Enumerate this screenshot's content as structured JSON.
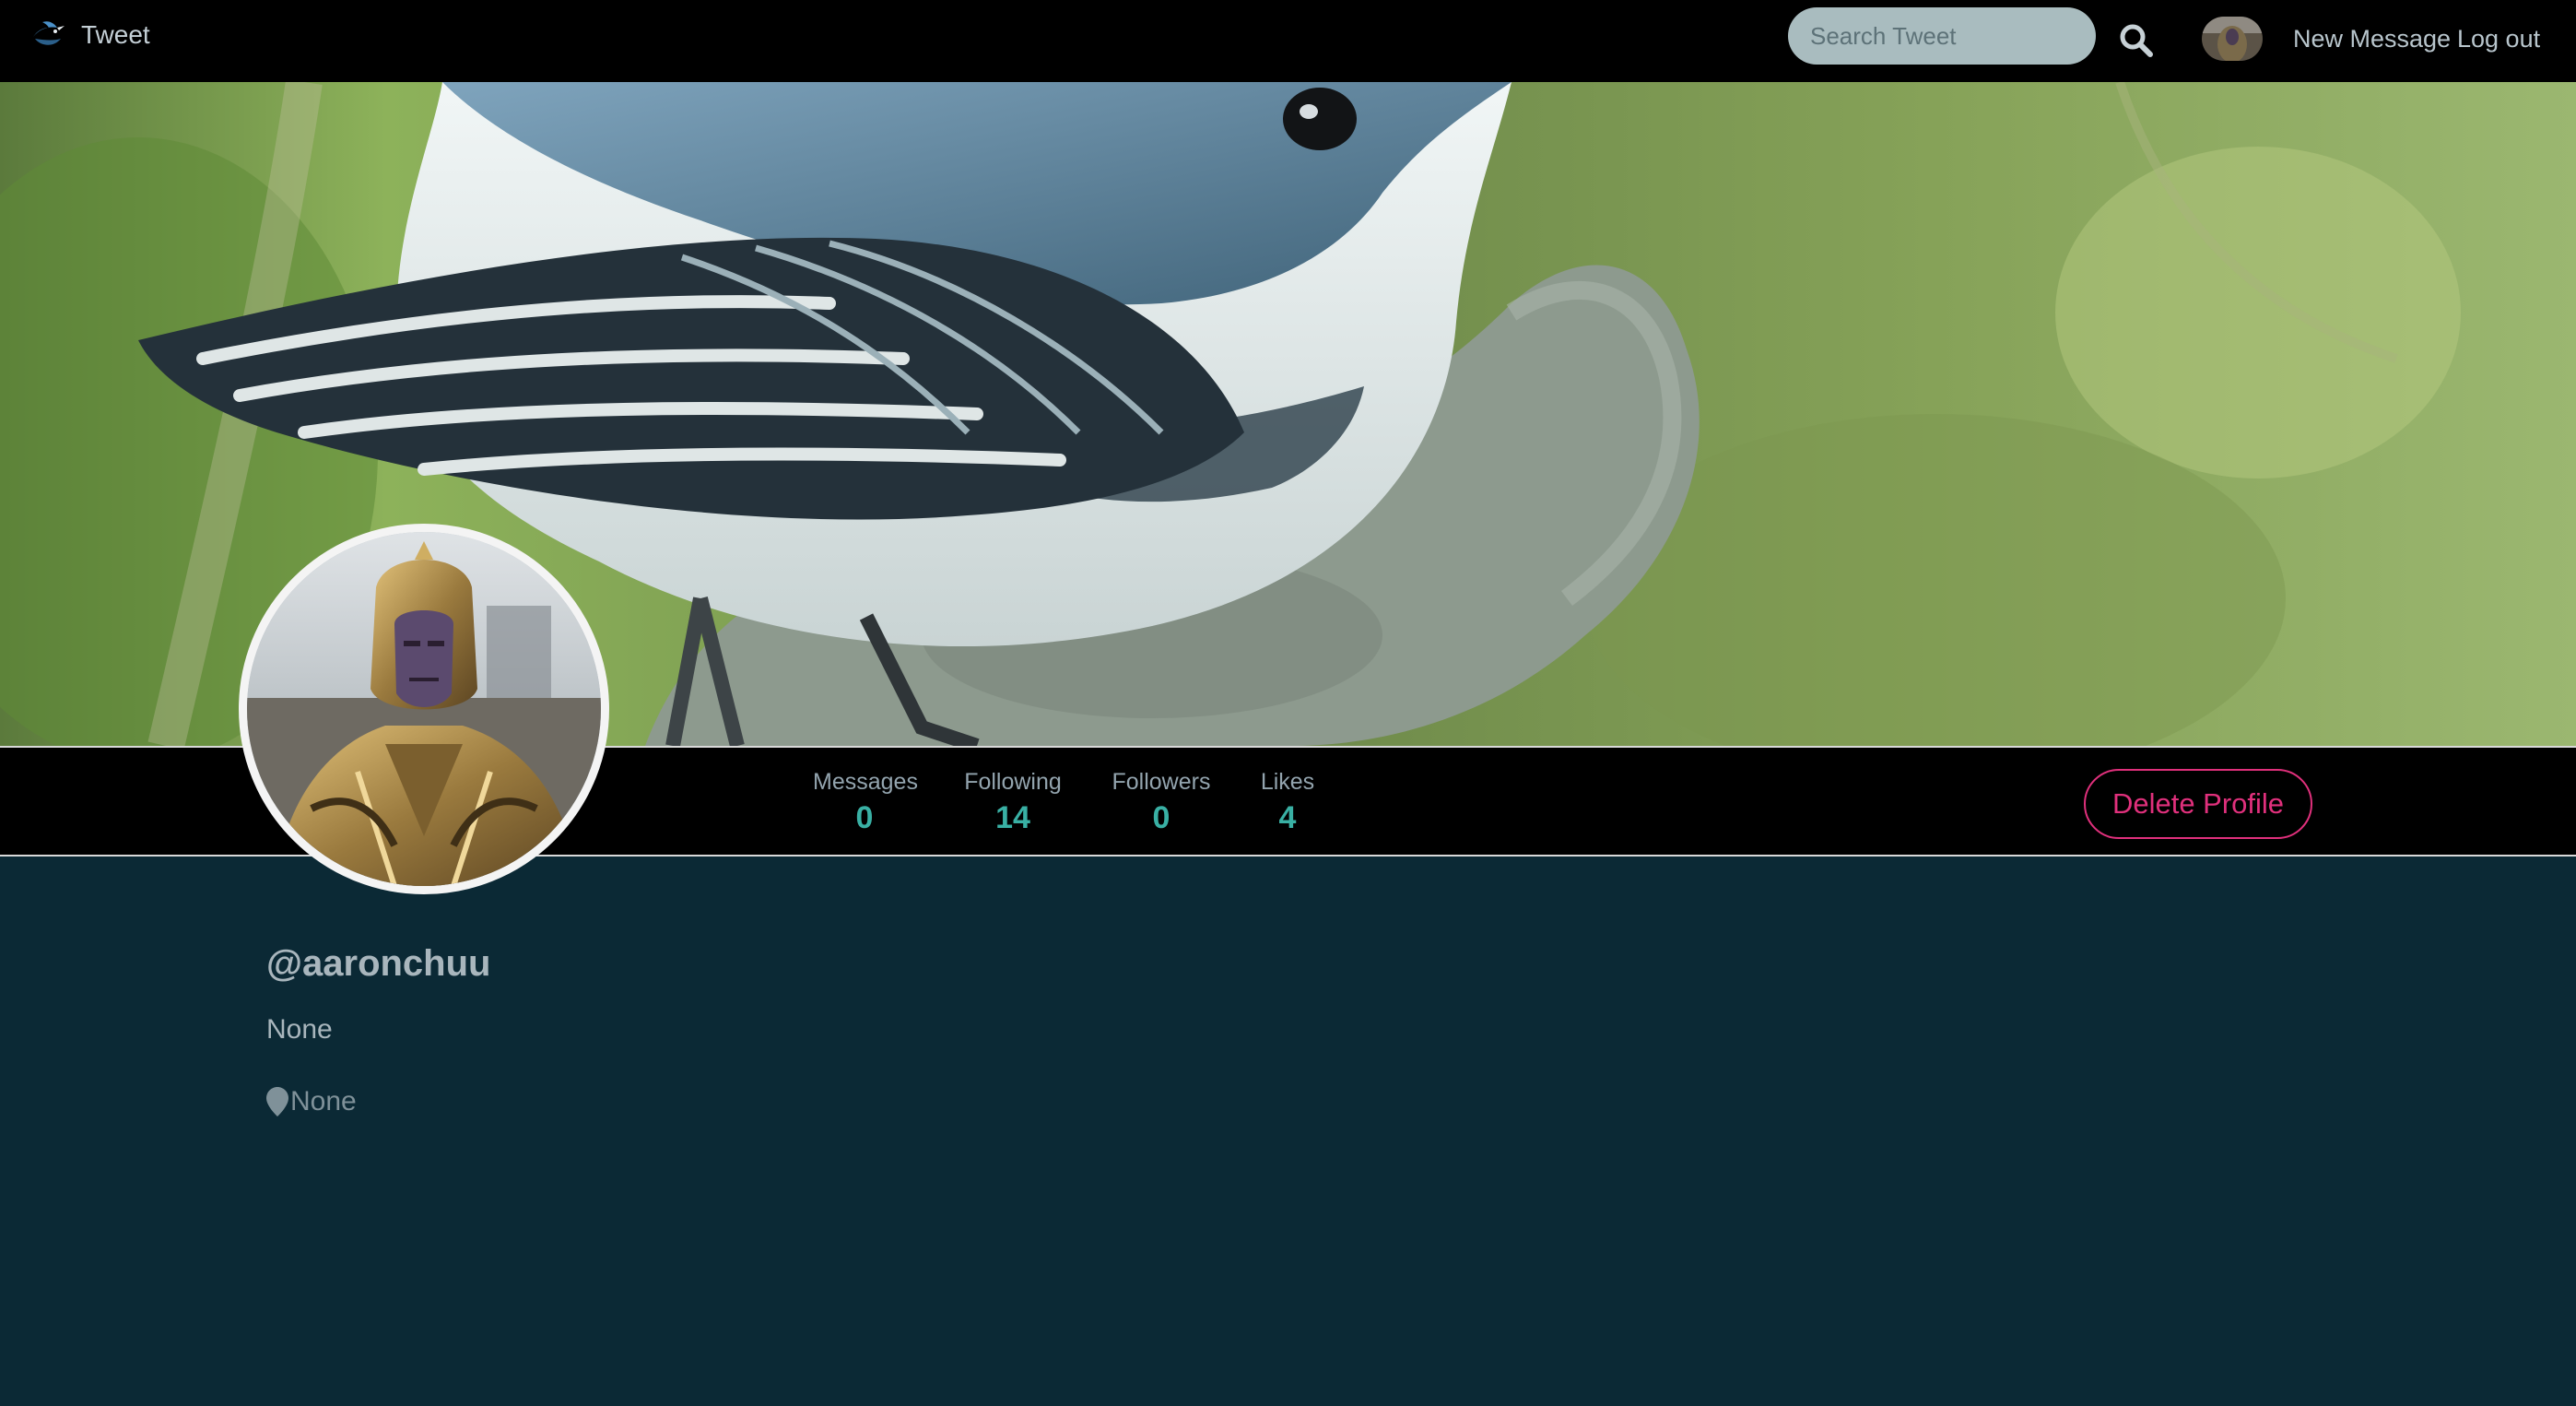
{
  "navbar": {
    "brand_label": "Tweet",
    "search_placeholder": "Search Tweet",
    "search_icon": "search-icon",
    "new_message_label": "New Message",
    "logout_label": "Log out"
  },
  "stats": [
    {
      "label": "Messages",
      "value": "0"
    },
    {
      "label": "Following",
      "value": "14"
    },
    {
      "label": "Followers",
      "value": "0"
    },
    {
      "label": "Likes",
      "value": "4"
    }
  ],
  "profile": {
    "delete_label": "Delete Profile",
    "username": "@aaronchuu",
    "bio": "None",
    "location": "None",
    "location_icon": "map-marker-icon"
  },
  "colors": {
    "page_background": "#0b2935",
    "navbar": "#000000",
    "stat_value": "#39b0a4",
    "delete_button": "#e0307c"
  }
}
